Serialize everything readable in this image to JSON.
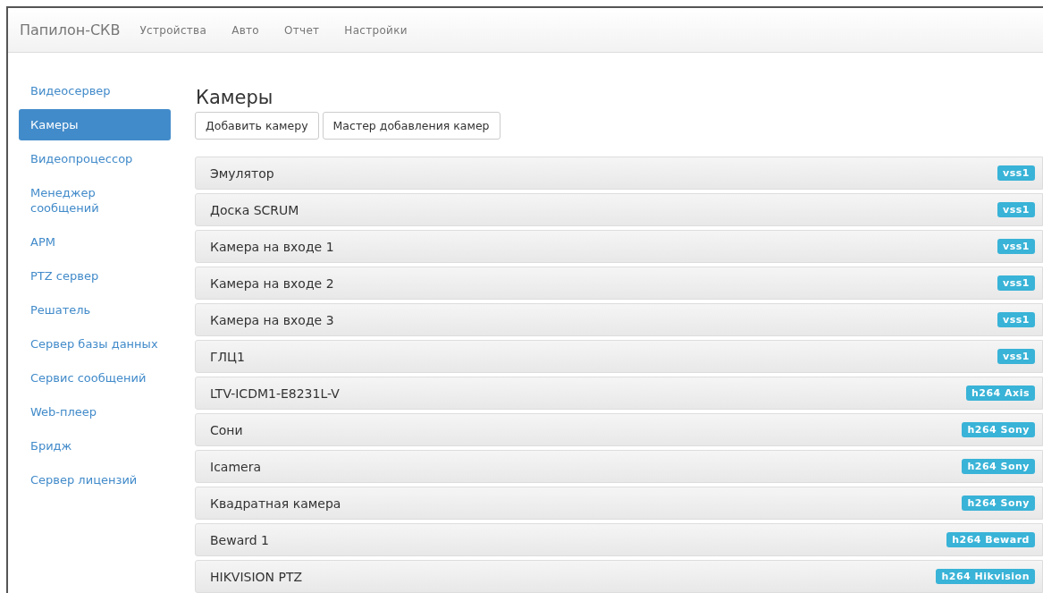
{
  "navbar": {
    "brand": "Папилон-СКВ",
    "items": [
      "Устройства",
      "Авто",
      "Отчет",
      "Настройки"
    ]
  },
  "sidebar": {
    "items": [
      {
        "label": "Видеосервер",
        "selected": false
      },
      {
        "label": "Камеры",
        "selected": true
      },
      {
        "label": "Видеопроцессор",
        "selected": false
      },
      {
        "label": "Менеджер сообщений",
        "selected": false
      },
      {
        "label": "АРМ",
        "selected": false
      },
      {
        "label": "PTZ сервер",
        "selected": false
      },
      {
        "label": "Решатель",
        "selected": false
      },
      {
        "label": "Сервер базы данных",
        "selected": false
      },
      {
        "label": "Сервис сообщений",
        "selected": false
      },
      {
        "label": "Web-плеер",
        "selected": false
      },
      {
        "label": "Бридж",
        "selected": false
      },
      {
        "label": "Сервер лицензий",
        "selected": false
      }
    ]
  },
  "title": "Камеры",
  "buttons": [
    "Добавить камеру",
    "Мастер добавления камер"
  ],
  "cameras": [
    {
      "name": "Эмулятор",
      "tag": "vss1"
    },
    {
      "name": "Доска SCRUM",
      "tag": "vss1"
    },
    {
      "name": "Камера на входе 1",
      "tag": "vss1"
    },
    {
      "name": "Камера на входе 2",
      "tag": "vss1"
    },
    {
      "name": "Камера на входе 3",
      "tag": "vss1"
    },
    {
      "name": "ГЛЦ1",
      "tag": "vss1"
    },
    {
      "name": "LTV-ICDM1-E8231L-V",
      "tag": "h264 Axis"
    },
    {
      "name": "Сони",
      "tag": "h264 Sony"
    },
    {
      "name": "Icamera",
      "tag": "h264 Sony"
    },
    {
      "name": "Квадратная камера",
      "tag": "h264 Sony"
    },
    {
      "name": "Beward 1",
      "tag": "h264 Beward"
    },
    {
      "name": "HIKVISION PTZ",
      "tag": "h264 Hikvision"
    }
  ]
}
